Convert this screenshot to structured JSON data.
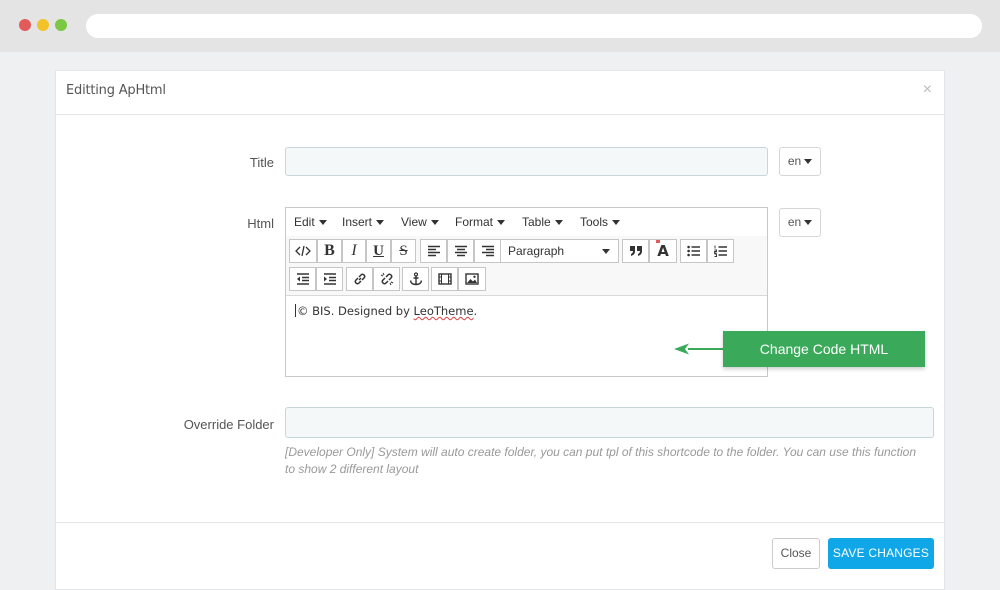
{
  "modal": {
    "title": "Editting ApHtml",
    "close_glyph": "×"
  },
  "form": {
    "title_label": "Title",
    "html_label": "Html",
    "override_label": "Override Folder",
    "title_value": "",
    "override_value": "",
    "lang_title": "en",
    "lang_html": "en",
    "override_help": "[Developer Only] System will auto create folder, you can put tpl of this shortcode to the folder. You can use this function to show 2 different layout"
  },
  "editor": {
    "menu": [
      "Edit",
      "Insert",
      "View",
      "Format",
      "Table",
      "Tools"
    ],
    "format_select": "Paragraph",
    "toolbar_icons": [
      "source-code-icon",
      "bold-icon",
      "italic-icon",
      "underline-icon",
      "strikethrough-icon",
      "align-left-icon",
      "align-center-icon",
      "align-right-icon",
      "format-select",
      "blockquote-icon",
      "text-color-icon",
      "bullet-list-icon",
      "numbered-list-icon",
      "outdent-icon",
      "indent-icon",
      "link-icon",
      "unlink-icon",
      "anchor-icon",
      "media-icon",
      "image-icon"
    ],
    "content_prefix": "© BIS. Designed by ",
    "content_link": "LeoTheme",
    "content_suffix": "."
  },
  "callout": {
    "label": "Change Code HTML",
    "color": "#3aaa5a"
  },
  "footer": {
    "close_label": "Close",
    "save_label": "SAVE CHANGES",
    "save_color": "#10a7e8"
  }
}
